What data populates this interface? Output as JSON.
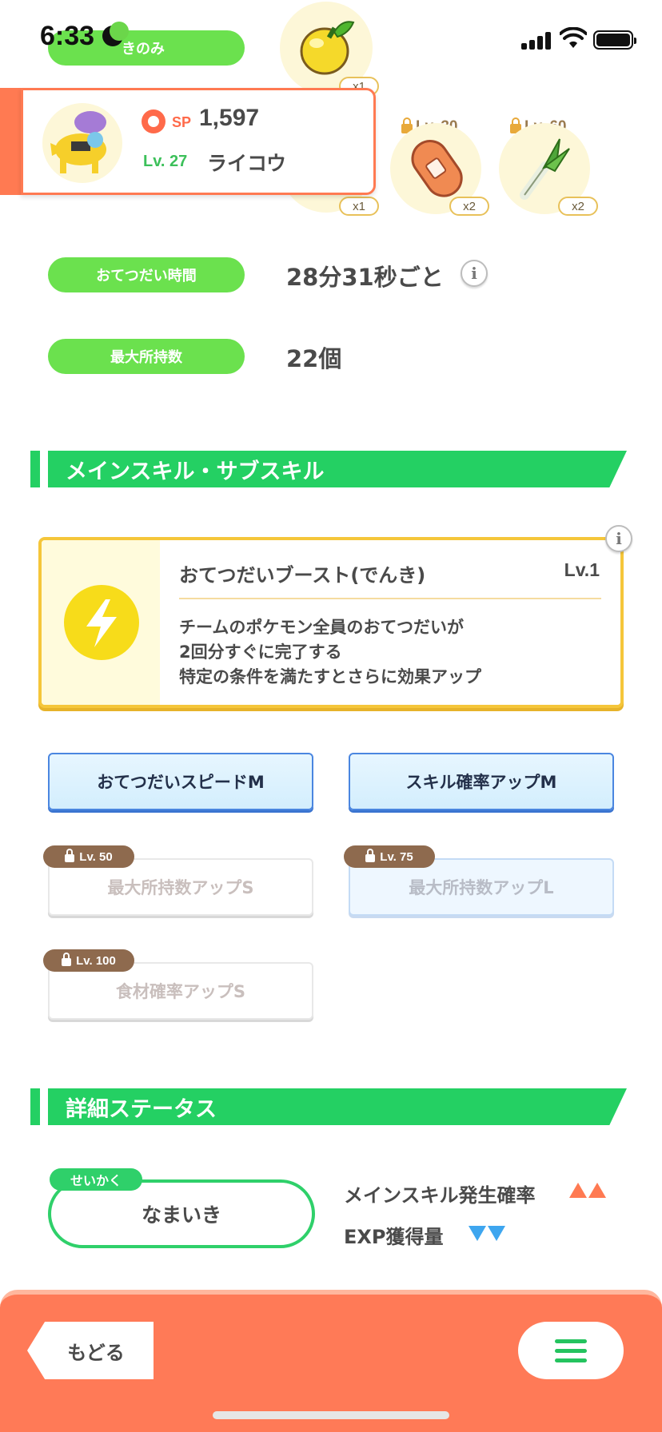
{
  "status_bar": {
    "time": "6:33"
  },
  "top_label": {
    "text": "きのみ"
  },
  "ingredients": [
    {
      "name": "lemon",
      "count": "x1"
    },
    {
      "name": "hidden",
      "count": "x1"
    },
    {
      "name": "sausage",
      "count": "x2",
      "lock_level": "Lv. 30"
    },
    {
      "name": "leek",
      "count": "x2",
      "lock_level": "Lv. 60"
    }
  ],
  "pokemon": {
    "sp_label": "SP",
    "sp_value": "1,597",
    "level": "Lv. 27",
    "name": "ライコウ"
  },
  "help_time": {
    "label": "おてつだい時間",
    "value": "28分31秒ごと"
  },
  "max_carry": {
    "label": "最大所持数",
    "value": "22個"
  },
  "skills_section": {
    "title": "メインスキル・サブスキル"
  },
  "main_skill": {
    "name": "おてつだいブースト(でんき)",
    "level": "Lv.1",
    "desc_line1": "チームのポケモン全員のおてつだいが",
    "desc_line2": "2回分すぐに完了する",
    "desc_line3": "特定の条件を満たすとさらに効果アップ"
  },
  "sub_skills": [
    {
      "label": "おてつだいスピードM",
      "lock": ""
    },
    {
      "label": "スキル確率アップM",
      "lock": ""
    },
    {
      "label": "最大所持数アップS",
      "lock": "Lv. 50"
    },
    {
      "label": "最大所持数アップL",
      "lock": "Lv. 75"
    },
    {
      "label": "食材確率アップS",
      "lock": "Lv. 100"
    }
  ],
  "details_section": {
    "title": "詳細ステータス"
  },
  "nature": {
    "tag": "せいかく",
    "value": "なまいき",
    "up_label": "メインスキル発生確率",
    "down_label": "EXP獲得量"
  },
  "bottom_nav": {
    "back_label": "もどる"
  },
  "colors": {
    "green": "#6be14e",
    "section_green": "#24d063",
    "orange": "#ff7a52",
    "up_arrow": "#ff7a52",
    "down_arrow": "#3ea6ef"
  }
}
